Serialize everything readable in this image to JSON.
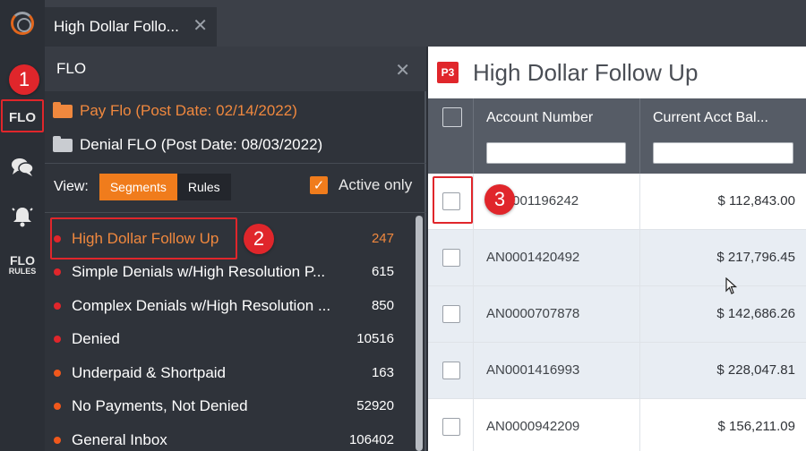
{
  "tab": {
    "title": "High Dollar Follo...",
    "close": "✕"
  },
  "rail": {
    "flo": "FLO",
    "flo_rules_a": "FLO",
    "flo_rules_b": "RULES"
  },
  "panel": {
    "title": "FLO",
    "close": "✕",
    "folders": [
      {
        "label": "Pay Flo (Post Date: 02/14/2022)",
        "color": "#f0883e"
      },
      {
        "label": "Denial FLO (Post Date: 08/03/2022)",
        "color": "#c9ccd1"
      }
    ],
    "view_label": "View:",
    "segments_label": "Segments",
    "rules_label": "Rules",
    "active_only_label": "Active only",
    "active_only_checked": true,
    "items": [
      {
        "label": "High Dollar Follow Up",
        "count": "247",
        "dot": "red",
        "selected": true
      },
      {
        "label": "Simple Denials w/High Resolution P...",
        "count": "615",
        "dot": "red"
      },
      {
        "label": "Complex Denials w/High Resolution ...",
        "count": "850",
        "dot": "red"
      },
      {
        "label": "Denied",
        "count": "10516",
        "dot": "red"
      },
      {
        "label": "Underpaid & Shortpaid",
        "count": "163",
        "dot": "orange"
      },
      {
        "label": "No Payments, Not Denied",
        "count": "52920",
        "dot": "orange"
      },
      {
        "label": "General Inbox",
        "count": "106402",
        "dot": "orange"
      }
    ]
  },
  "callouts": [
    "1",
    "2",
    "3"
  ],
  "main": {
    "badge": "P3",
    "title": "High Dollar Follow Up",
    "columns": [
      "Account Number",
      "Current Acct Bal..."
    ],
    "rows": [
      {
        "account": "AN0001196242",
        "balance": "$ 112,843.00"
      },
      {
        "account": "AN0001420492",
        "balance": "$ 217,796.45"
      },
      {
        "account": "AN0000707878",
        "balance": "$ 142,686.26"
      },
      {
        "account": "AN0001416993",
        "balance": "$ 228,047.81"
      },
      {
        "account": "AN0000942209",
        "balance": "$ 156,211.09"
      }
    ]
  },
  "colors": {
    "accent": "#f07c1c",
    "highlight": "#e0262b",
    "panel": "#2f333a"
  }
}
